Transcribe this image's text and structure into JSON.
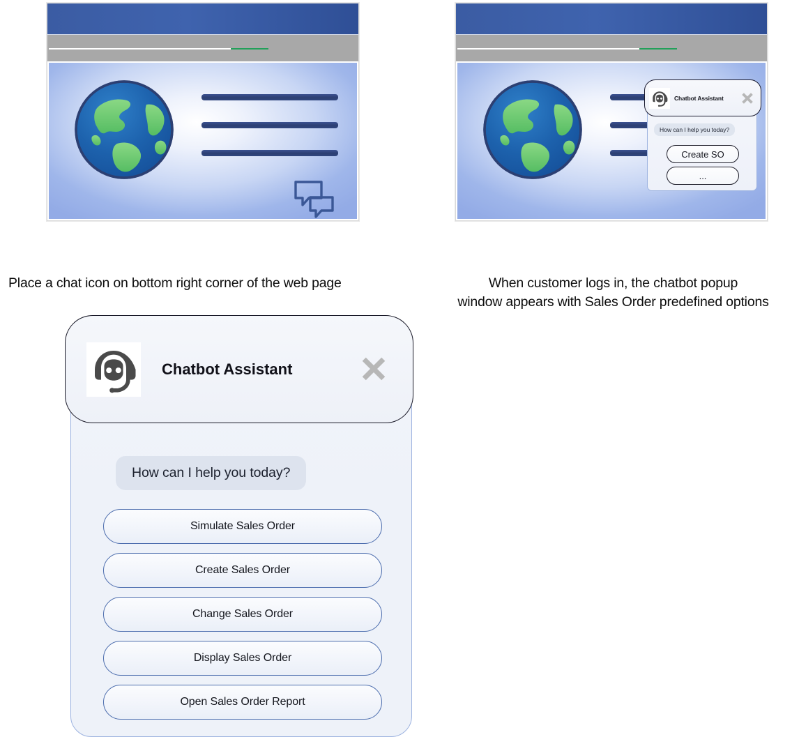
{
  "browser_left": {
    "name": "web-page-mockup-with-chat-icon",
    "chat_icon_name": "chat-bubbles-icon",
    "globe_icon_name": "globe-icon",
    "content_line_count": 3
  },
  "browser_right": {
    "name": "web-page-mockup-with-chatbot-popup",
    "popup": {
      "title": "Chatbot Assistant",
      "close_label": "✕",
      "greeting": "How can I help you today?",
      "options": [
        "Create SO",
        "..."
      ]
    }
  },
  "captions": {
    "left": "Place a chat icon on bottom right corner of the web page",
    "right_line1": "When customer logs in, the chatbot popup",
    "right_line2": "window appears with Sales Order predefined options"
  },
  "chat_panel": {
    "title": "Chatbot Assistant",
    "close_label": "✕",
    "greeting": "How can I help you today?",
    "options": [
      "Simulate Sales Order",
      "Create Sales Order",
      "Change Sales Order",
      "Display Sales Order",
      "Open Sales Order Report"
    ]
  },
  "colors": {
    "browser_header_blue": "#3b5ca3",
    "browser_toolbar_gray": "#a8a8a8",
    "toolbar_green": "#22a05a",
    "content_bar_navy": "#2c3f72",
    "bot_icon_gray": "#4a4a4a",
    "close_icon_gray": "#b7b7b7",
    "bubble_bg": "#dde3ee",
    "option_border_blue": "#4b6cad",
    "panel_border_blue": "#9db3e0",
    "header_border_dark": "#171726",
    "globe_ocean_blue": "#1e5fa8",
    "globe_land_green": "#79cc73"
  }
}
